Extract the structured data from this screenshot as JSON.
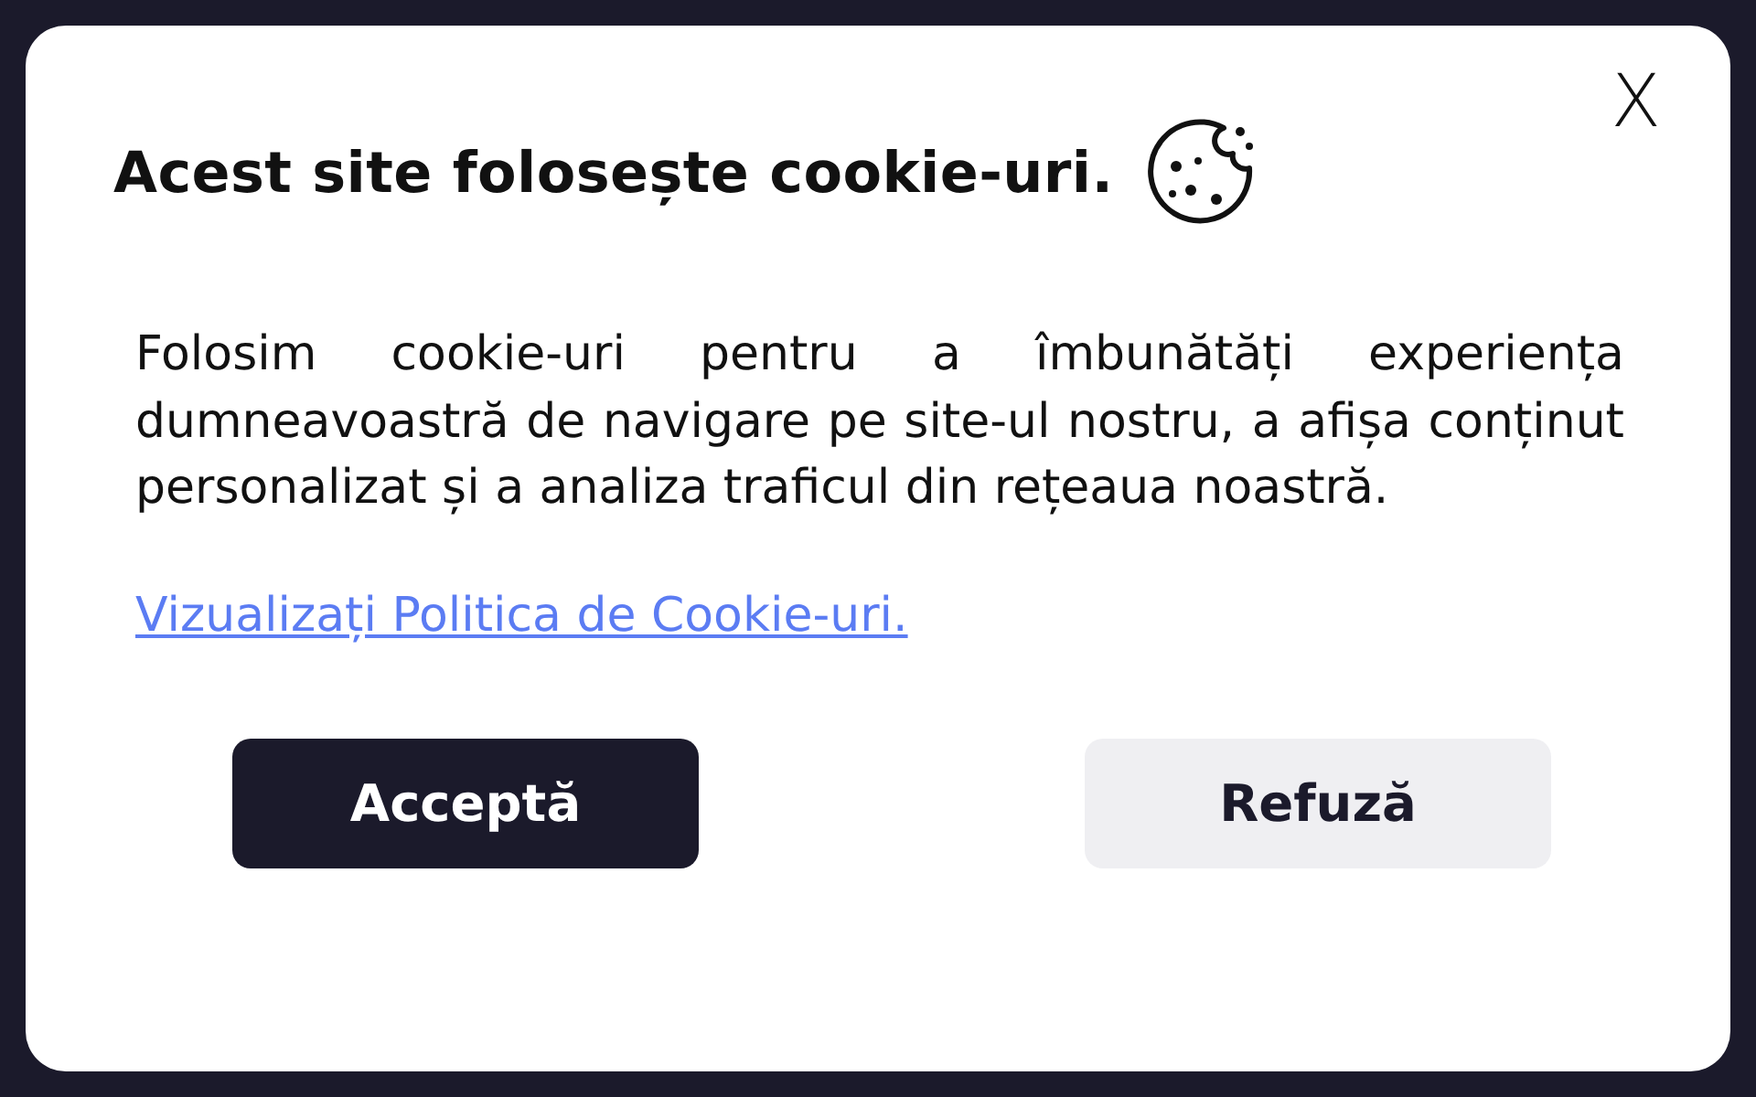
{
  "dialog": {
    "title": "Acest site folosește cookie-uri.",
    "close": "X",
    "message": "Folosim cookie-uri pentru a îmbunătăți experiența dumneavoastră de navigare pe site-ul nostru, a afișa conținut personalizat și a analiza traficul din rețeaua noastră.",
    "link": "Vizualizați Politica de Cookie-uri.",
    "buttons": [
      {
        "label": "Acceptă",
        "kind": "primary"
      },
      {
        "label": "Refuză",
        "kind": "secondary"
      }
    ]
  }
}
